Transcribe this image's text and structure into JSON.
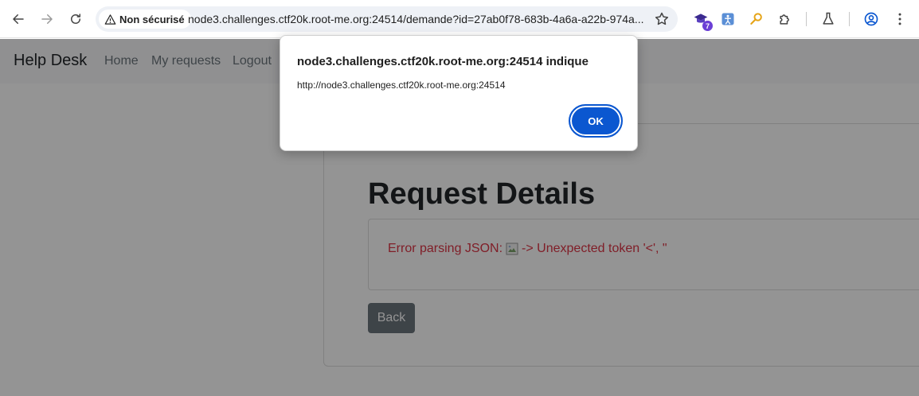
{
  "browser": {
    "security_label": "Non sécurisé",
    "url": "node3.challenges.ctf20k.root-me.org:24514/demande?id=27ab0f78-683b-4a6a-a22b-974a...",
    "extension_badge": "7"
  },
  "navbar": {
    "brand": "Help Desk",
    "links": [
      "Home",
      "My requests",
      "Logout"
    ]
  },
  "main": {
    "title": "Request Details",
    "error_prefix": "Error parsing JSON:",
    "error_suffix": "-> Unexpected token '<', \"",
    "back_label": "Back"
  },
  "dialog": {
    "title": "node3.challenges.ctf20k.root-me.org:24514 indique",
    "message": "http://node3.challenges.ctf20k.root-me.org:24514",
    "ok_label": "OK"
  },
  "colors": {
    "accent": "#0b57d0",
    "error": "#dc3545",
    "secondary_button": "#6c757d"
  }
}
